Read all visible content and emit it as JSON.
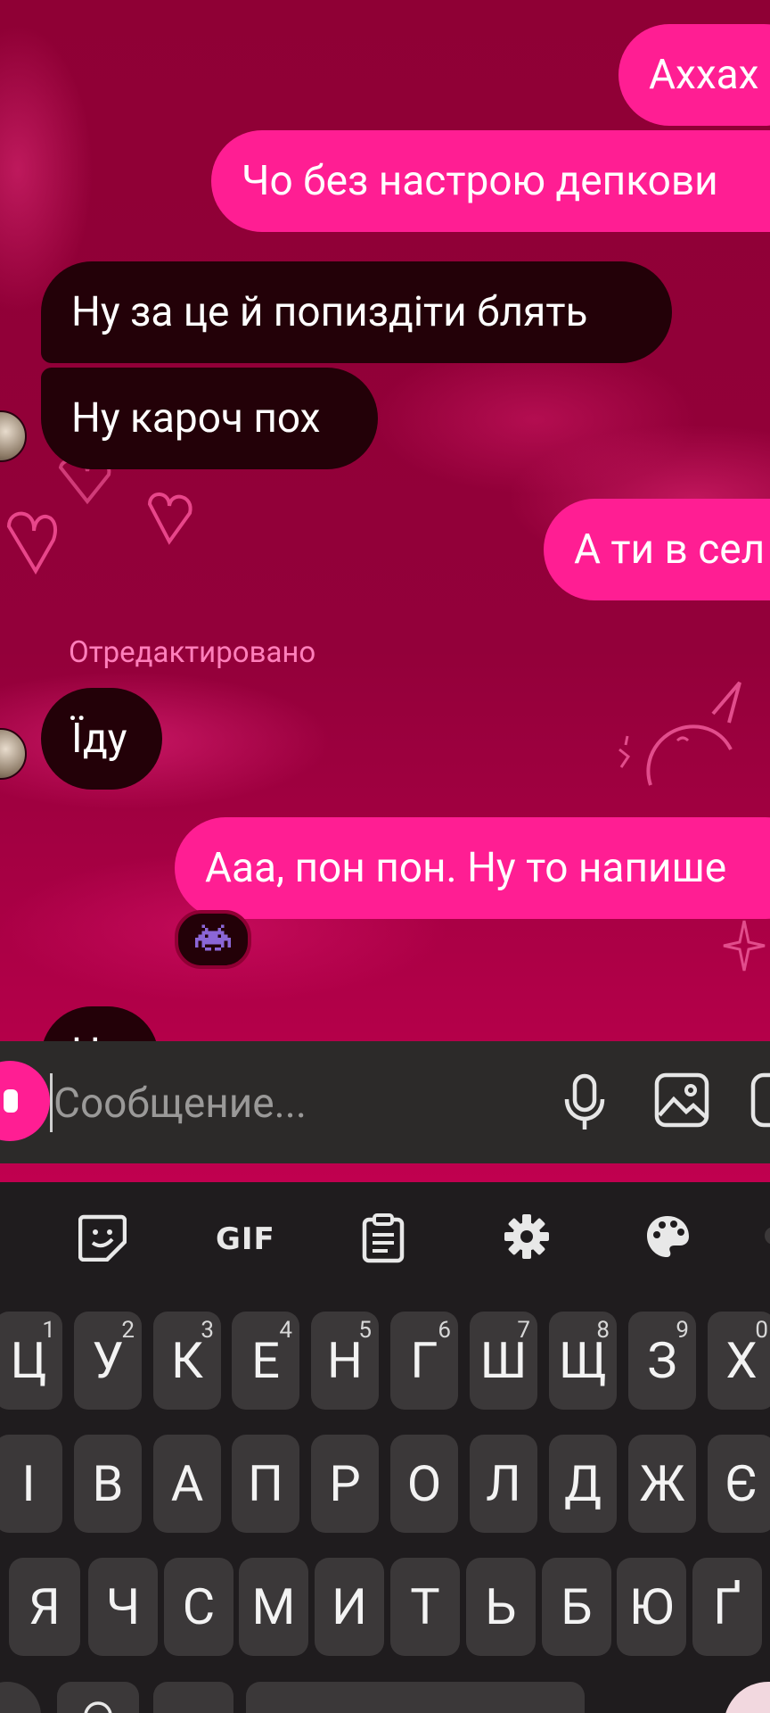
{
  "chat": {
    "messages": [
      {
        "side": "out",
        "text": "Аххах"
      },
      {
        "side": "out",
        "text": "Чо без настрою депкови"
      },
      {
        "side": "in",
        "text": "Ну за це й попиздіти блять"
      },
      {
        "side": "in",
        "text": "Ну кароч пох"
      },
      {
        "side": "out",
        "text": "А ти в сел"
      },
      {
        "side": "in",
        "text": "Їду",
        "edited_label": "Отредактировано"
      },
      {
        "side": "out",
        "text": "Ааа, пон пон. Ну то напише",
        "reaction": "👾"
      }
    ],
    "partial_bubble_text": "Н"
  },
  "composer": {
    "placeholder": "Сообщение...",
    "icons": [
      "camera-icon",
      "microphone-icon",
      "gallery-icon",
      "sticker-icon"
    ]
  },
  "keyboard": {
    "toolbar": {
      "icons": [
        "emoji-sticker-icon",
        "gif-icon",
        "clipboard-icon",
        "settings-icon",
        "palette-icon"
      ],
      "gif_label": "GIF"
    },
    "row1": [
      {
        "label": "Ц",
        "hint": "1"
      },
      {
        "label": "У",
        "hint": "2"
      },
      {
        "label": "К",
        "hint": "3"
      },
      {
        "label": "Е",
        "hint": "4"
      },
      {
        "label": "Н",
        "hint": "5"
      },
      {
        "label": "Г",
        "hint": "6"
      },
      {
        "label": "Ш",
        "hint": "7"
      },
      {
        "label": "Щ",
        "hint": "8"
      },
      {
        "label": "З",
        "hint": "9"
      },
      {
        "label": "Х",
        "hint": "0"
      }
    ],
    "row2": [
      "І",
      "В",
      "А",
      "П",
      "Р",
      "О",
      "Л",
      "Д",
      "Ж",
      "Є"
    ],
    "row3": [
      "Я",
      "Ч",
      "С",
      "М",
      "И",
      "Т",
      "Ь",
      "Б",
      "Ю",
      "Ґ"
    ]
  },
  "colors": {
    "outgoing_bubble": "#ff1e93",
    "incoming_bubble": "#230108",
    "chat_background": "#8e0034",
    "edited_label": "#ff7fbb",
    "keyboard_bg": "#1f1c1e",
    "key_bg": "#3b3839"
  }
}
